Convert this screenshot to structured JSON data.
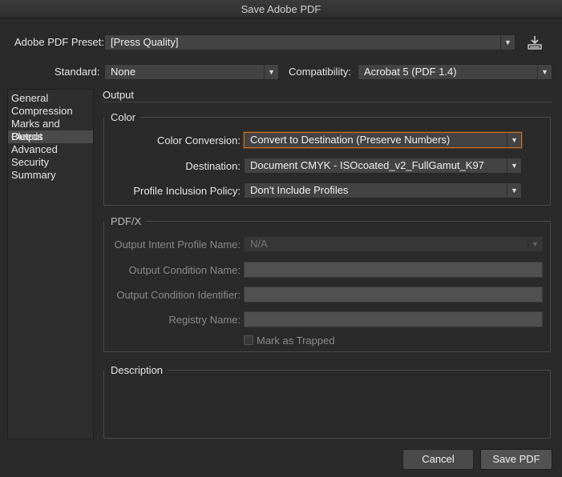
{
  "window": {
    "title": "Save Adobe PDF"
  },
  "preset": {
    "label": "Adobe PDF Preset:",
    "value": "[Press Quality]"
  },
  "standard": {
    "label": "Standard:",
    "value": "None"
  },
  "compatibility": {
    "label": "Compatibility:",
    "value": "Acrobat 5 (PDF 1.4)"
  },
  "sidebar": {
    "items": [
      {
        "label": "General"
      },
      {
        "label": "Compression"
      },
      {
        "label": "Marks and Bleeds"
      },
      {
        "label": "Output",
        "selected": true
      },
      {
        "label": "Advanced"
      },
      {
        "label": "Security"
      },
      {
        "label": "Summary"
      }
    ]
  },
  "main": {
    "section_title": "Output",
    "color": {
      "title": "Color",
      "conversion": {
        "label": "Color Conversion:",
        "value": "Convert to Destination (Preserve Numbers)"
      },
      "destination": {
        "label": "Destination:",
        "value": "Document CMYK - ISOcoated_v2_FullGamut_K97"
      },
      "profile_policy": {
        "label": "Profile Inclusion Policy:",
        "value": "Don't Include Profiles"
      }
    },
    "pdfx": {
      "title": "PDF/X",
      "intent_profile": {
        "label": "Output Intent Profile Name:",
        "value": "N/A"
      },
      "condition_name": {
        "label": "Output Condition Name:",
        "value": ""
      },
      "condition_id": {
        "label": "Output Condition Identifier:",
        "value": ""
      },
      "registry": {
        "label": "Registry Name:",
        "value": ""
      },
      "trapped": {
        "label": "Mark as Trapped",
        "checked": false
      }
    },
    "description": {
      "title": "Description",
      "text": ""
    }
  },
  "buttons": {
    "cancel": "Cancel",
    "save": "Save PDF"
  },
  "icons": {
    "save_preset": "save-preset-icon",
    "dropdown_arrow": "chevron-down-icon"
  },
  "colors": {
    "focus_ring": "#c8762c"
  }
}
